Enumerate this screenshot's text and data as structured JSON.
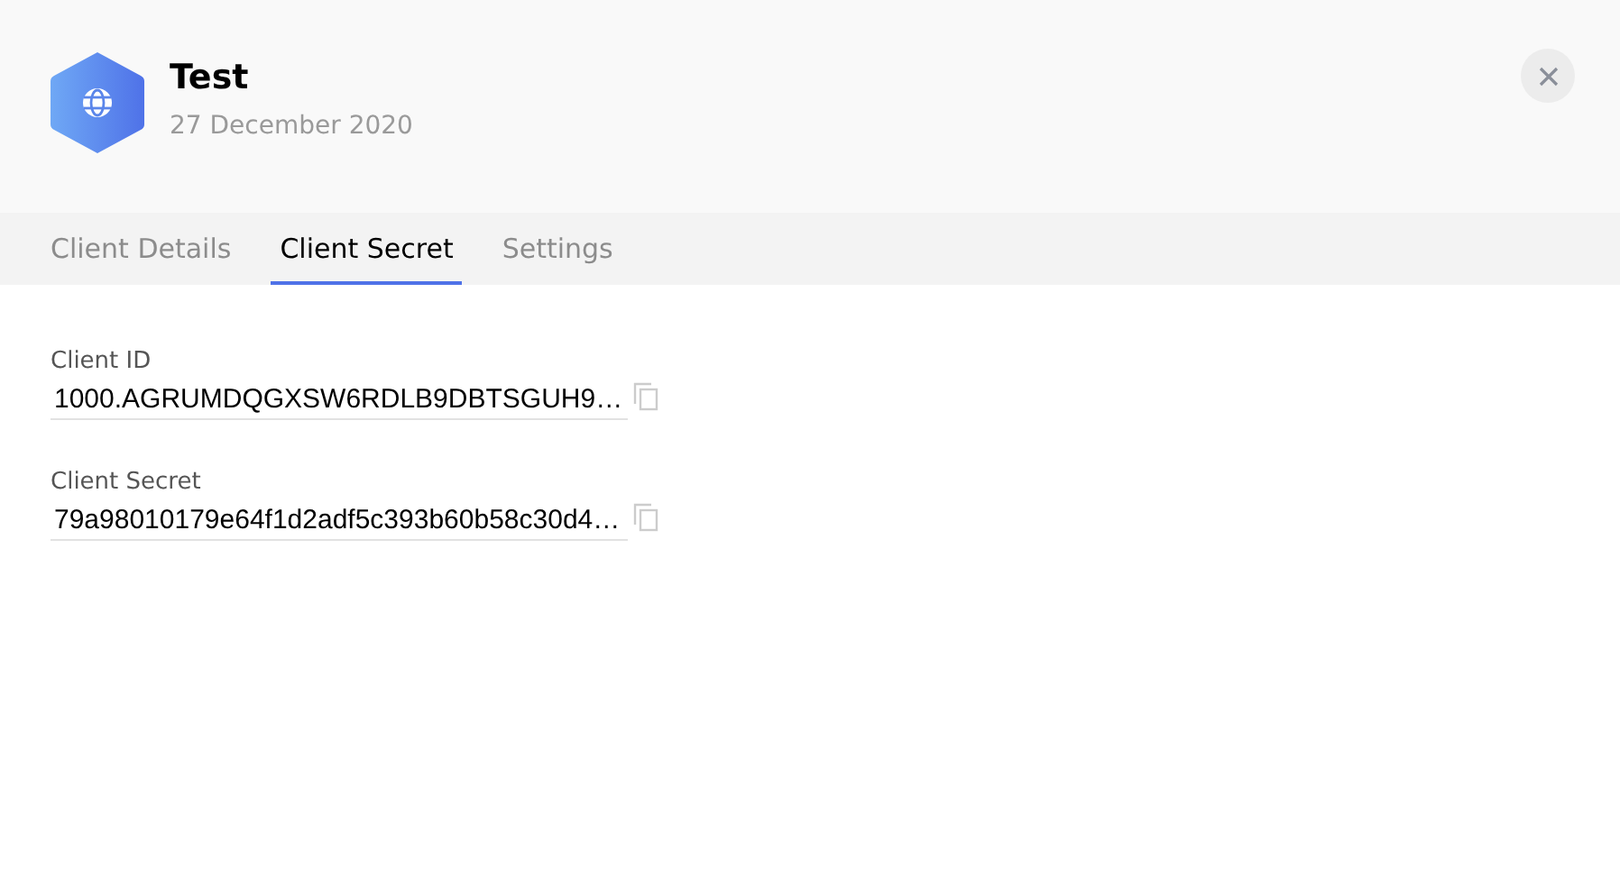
{
  "header": {
    "title": "Test",
    "date": "27 December 2020"
  },
  "tabs": [
    {
      "label": "Client Details",
      "selected": false
    },
    {
      "label": "Client Secret",
      "selected": true
    },
    {
      "label": "Settings",
      "selected": false
    }
  ],
  "fields": [
    {
      "label": "Client ID",
      "value": "1000.AGRUMDQGXSW6RDLB9DBTSGUH9…"
    },
    {
      "label": "Client Secret",
      "value": "79a98010179e64f1d2adf5c393b60b58c30d4…"
    }
  ]
}
